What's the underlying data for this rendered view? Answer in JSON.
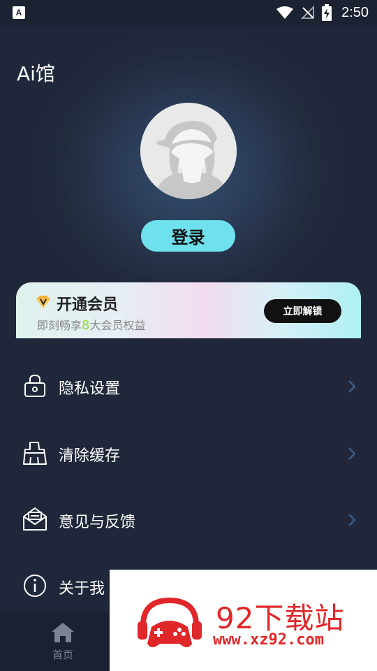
{
  "status_bar": {
    "app_icon_letter": "A",
    "time": "2:50",
    "icons": [
      "wifi-icon",
      "no-signal-icon",
      "battery-charging-icon"
    ]
  },
  "header": {
    "title": "Ai馆"
  },
  "profile": {
    "avatar": "default-avatar-icon",
    "login_label": "登录"
  },
  "vip_banner": {
    "icon": "diamond-icon",
    "title": "开通会员",
    "subtitle_prefix": "即刻畅享",
    "subtitle_number": "8",
    "subtitle_suffix": "大会员权益",
    "button_label": "立即解锁"
  },
  "menu": {
    "items": [
      {
        "label": "隐私设置",
        "icon": "lock-icon"
      },
      {
        "label": "清除缓存",
        "icon": "broom-icon"
      },
      {
        "label": "意见与反馈",
        "icon": "mail-icon"
      },
      {
        "label": "关于我",
        "icon": "info-icon"
      }
    ]
  },
  "bottom_nav": {
    "home_label": "首页",
    "home_icon": "home-icon"
  },
  "watermark": {
    "title": "92下载站",
    "url": "www.xz92.com"
  },
  "colors": {
    "background": "#20273a",
    "login_button": "#6fe0ee",
    "watermark_red": "#e0272a",
    "chevron": "#3f5b86"
  }
}
